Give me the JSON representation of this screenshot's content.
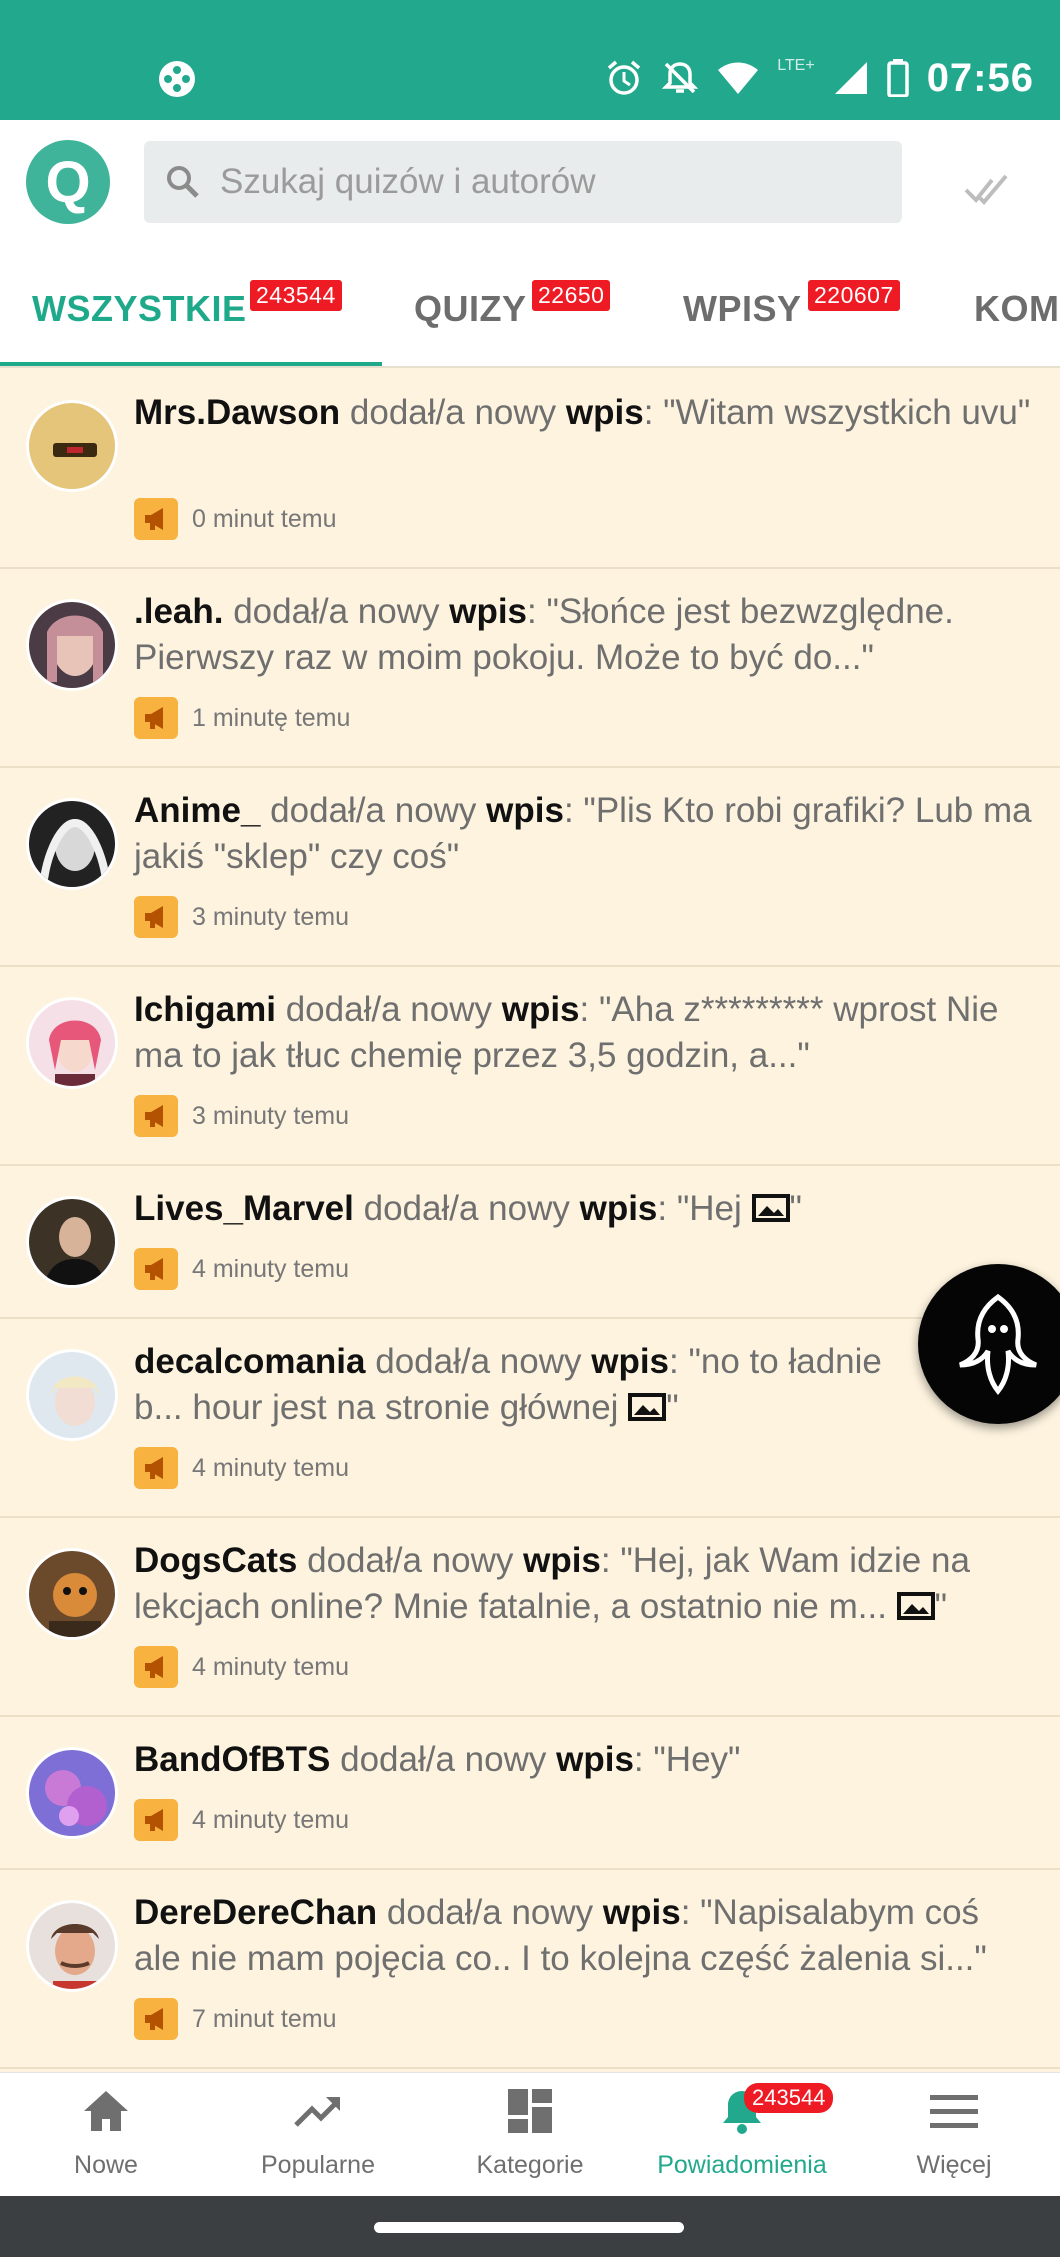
{
  "status_bar": {
    "time": "07:56",
    "network": "LTE+"
  },
  "search": {
    "placeholder": "Szukaj quizów i autorów"
  },
  "logo_letter": "Q",
  "tabs": [
    {
      "label": "WSZYSTKIE",
      "count": "243544",
      "active": true
    },
    {
      "label": "QUIZY",
      "count": "22650",
      "active": false
    },
    {
      "label": "WPISY",
      "count": "220607",
      "active": false
    },
    {
      "label": "KOM",
      "count": "",
      "active": false
    }
  ],
  "action_text": "dodał/a nowy",
  "entry_type": "wpis",
  "feed": [
    {
      "user": "Mrs.Dawson",
      "quote_open": ": \"Witam wszystkich uvu\"",
      "has_image": false,
      "time": "0 minut temu"
    },
    {
      "user": ".leah.",
      "quote_open": ": \"Słońce jest bezwzględne. Pierwszy raz w moim pokoju. Może to być do...\"",
      "has_image": false,
      "time": "1 minutę temu"
    },
    {
      "user": "Anime_",
      "quote_open": ": \"Plis Kto robi grafiki? Lub ma jakiś \"sklep\" czy coś\"",
      "has_image": false,
      "time": "3 minuty temu"
    },
    {
      "user": "Ichigami",
      "quote_open": ": \"Aha z********* wprost Nie ma to jak tłuc chemię przez 3,5 godzin, a...\"",
      "has_image": false,
      "time": "3 minuty temu"
    },
    {
      "user": "Lives_Marvel",
      "quote_open": ": \"Hej",
      "quote_close": "\"",
      "has_image": true,
      "time": "4 minuty temu"
    },
    {
      "user": "decalcomania",
      "quote_open": ": \"no to ładnie b... hour jest na stronie głównej",
      "quote_close": "\"",
      "has_image": true,
      "time": "4 minuty temu"
    },
    {
      "user": "DogsCats",
      "quote_open": ": \"Hej, jak Wam idzie na lekcjach online? Mnie fatalnie, a ostatnio nie m...",
      "quote_close": "\"",
      "has_image": true,
      "time": "4 minuty temu"
    },
    {
      "user": "BandOfBTS",
      "quote_open": ": \"Hey\"",
      "has_image": false,
      "time": "4 minuty temu"
    },
    {
      "user": "DereDereChan",
      "quote_open": ": \"Napisalabym coś ale nie mam pojęcia co.. I to kolejna część żalenia si...\"",
      "has_image": false,
      "time": "7 minut temu"
    }
  ],
  "bottom_nav": [
    {
      "label": "Nowe",
      "icon": "home-icon"
    },
    {
      "label": "Popularne",
      "icon": "trending-icon"
    },
    {
      "label": "Kategorie",
      "icon": "grid-icon"
    },
    {
      "label": "Powiadomienia",
      "icon": "bell-icon",
      "badge": "243544",
      "active": true
    },
    {
      "label": "Więcej",
      "icon": "menu-icon"
    }
  ],
  "colors": {
    "primary": "#22a98d",
    "badge": "#ee1b24",
    "feed_bg": "#fdf3df",
    "megaphone": "#f7b23f"
  }
}
